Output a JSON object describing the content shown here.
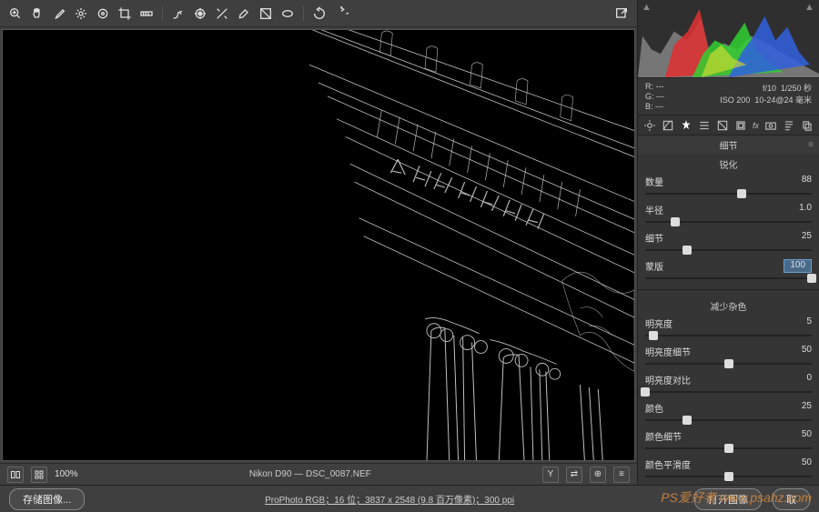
{
  "toolbar": {
    "icons": [
      "zoom",
      "hand",
      "eyedropper",
      "sampler",
      "target",
      "crop",
      "straighten",
      "spot",
      "redeye",
      "adjust",
      "brush",
      "grad",
      "radial",
      "rotate-ccw",
      "rotate-cw"
    ],
    "right_icons": [
      "export"
    ]
  },
  "status": {
    "zoom": "100%",
    "camera_file": "Nikon D90 — DSC_0087.NEF"
  },
  "footer": {
    "save_label": "存储图像...",
    "info": "ProPhoto RGB；16 位；3837 x 2548 (9.8 百万像素)；300 ppi",
    "open_label": "打开图像",
    "cancel_label": "取"
  },
  "readouts": {
    "r": "R: ---",
    "g": "G: ---",
    "b": "B: ---",
    "aperture": "f/10",
    "shutter": "1/250 秒",
    "iso": "ISO 200",
    "lens": "10-24@24 毫米"
  },
  "panel": {
    "header": "细节",
    "sharpen": {
      "title": "锐化",
      "amount_label": "数量",
      "amount": "88",
      "radius_label": "半径",
      "radius": "1.0",
      "detail_label": "细节",
      "detail": "25",
      "mask_label": "蒙版",
      "mask": "100"
    },
    "nr": {
      "title": "减少杂色",
      "lum_label": "明亮度",
      "lum": "5",
      "lumd_label": "明亮度细节",
      "lumd": "50",
      "lumc_label": "明亮度对比",
      "lumc": "0",
      "col_label": "颜色",
      "col": "25",
      "cold_label": "颜色细节",
      "cold": "50",
      "cols_label": "颜色平滑度",
      "cols": "50"
    }
  },
  "watermark": "PS爱好者\nwww.psahz.com"
}
